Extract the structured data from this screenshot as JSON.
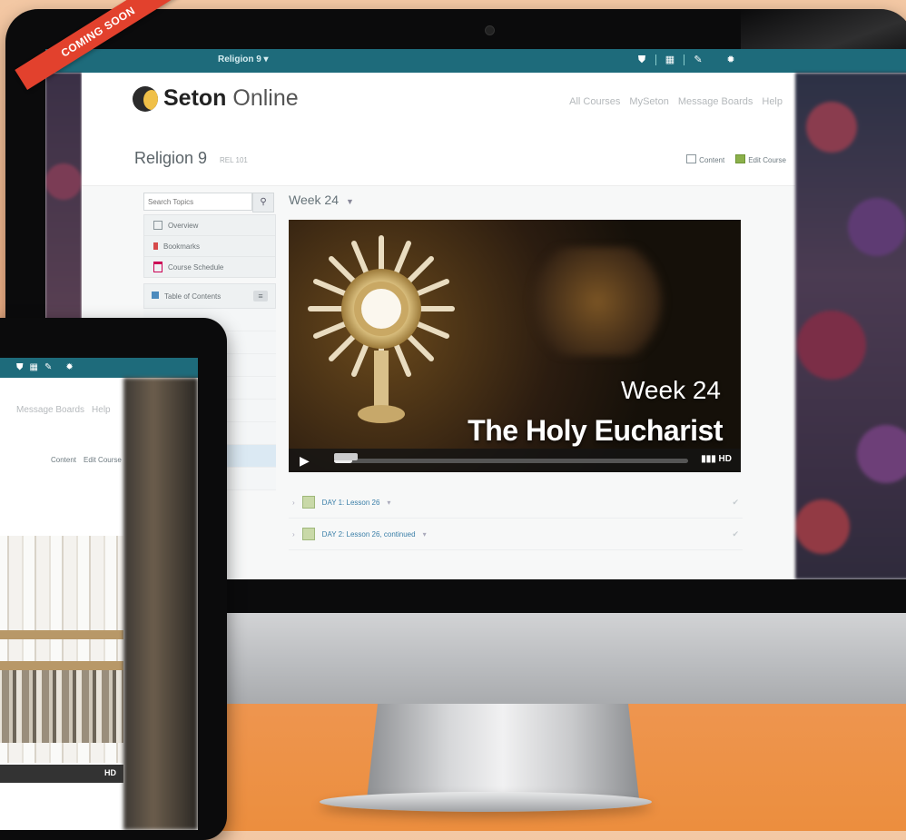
{
  "banner": {
    "label": "COMING SOON"
  },
  "topbar": {
    "course_select": "Religion 9 ▾",
    "icons": [
      "shield-icon",
      "grid-icon",
      "chat-icon",
      "gear-icon"
    ]
  },
  "brand": {
    "name_bold": "Seton",
    "name_light": " Online"
  },
  "nav": {
    "items": [
      "All Courses",
      "MySeton",
      "Message Boards",
      "Help"
    ]
  },
  "course": {
    "title": "Religion 9",
    "code": "REL 101",
    "actions": [
      "Content",
      "Edit Course"
    ]
  },
  "sidebar": {
    "search_placeholder": "Search Topics",
    "items": [
      "Overview",
      "Bookmarks",
      "Course Schedule"
    ],
    "toc_label": "Table of Contents",
    "toc_toggle": "≡"
  },
  "main": {
    "week_heading": "Week 24",
    "video": {
      "week_label": "Week 24",
      "title": "The Holy Eucharist",
      "hd_label": "HD"
    },
    "lessons": [
      "DAY 1: Lesson 26",
      "DAY 2: Lesson 26, continued"
    ]
  },
  "tablet": {
    "nav": [
      "Message Boards",
      "Help"
    ],
    "actions": [
      "Content",
      "Edit Course"
    ],
    "hd_label": "HD"
  },
  "colors": {
    "accent": "#1e6b7b",
    "banner": "#e2412d",
    "link": "#3b7fa8"
  }
}
